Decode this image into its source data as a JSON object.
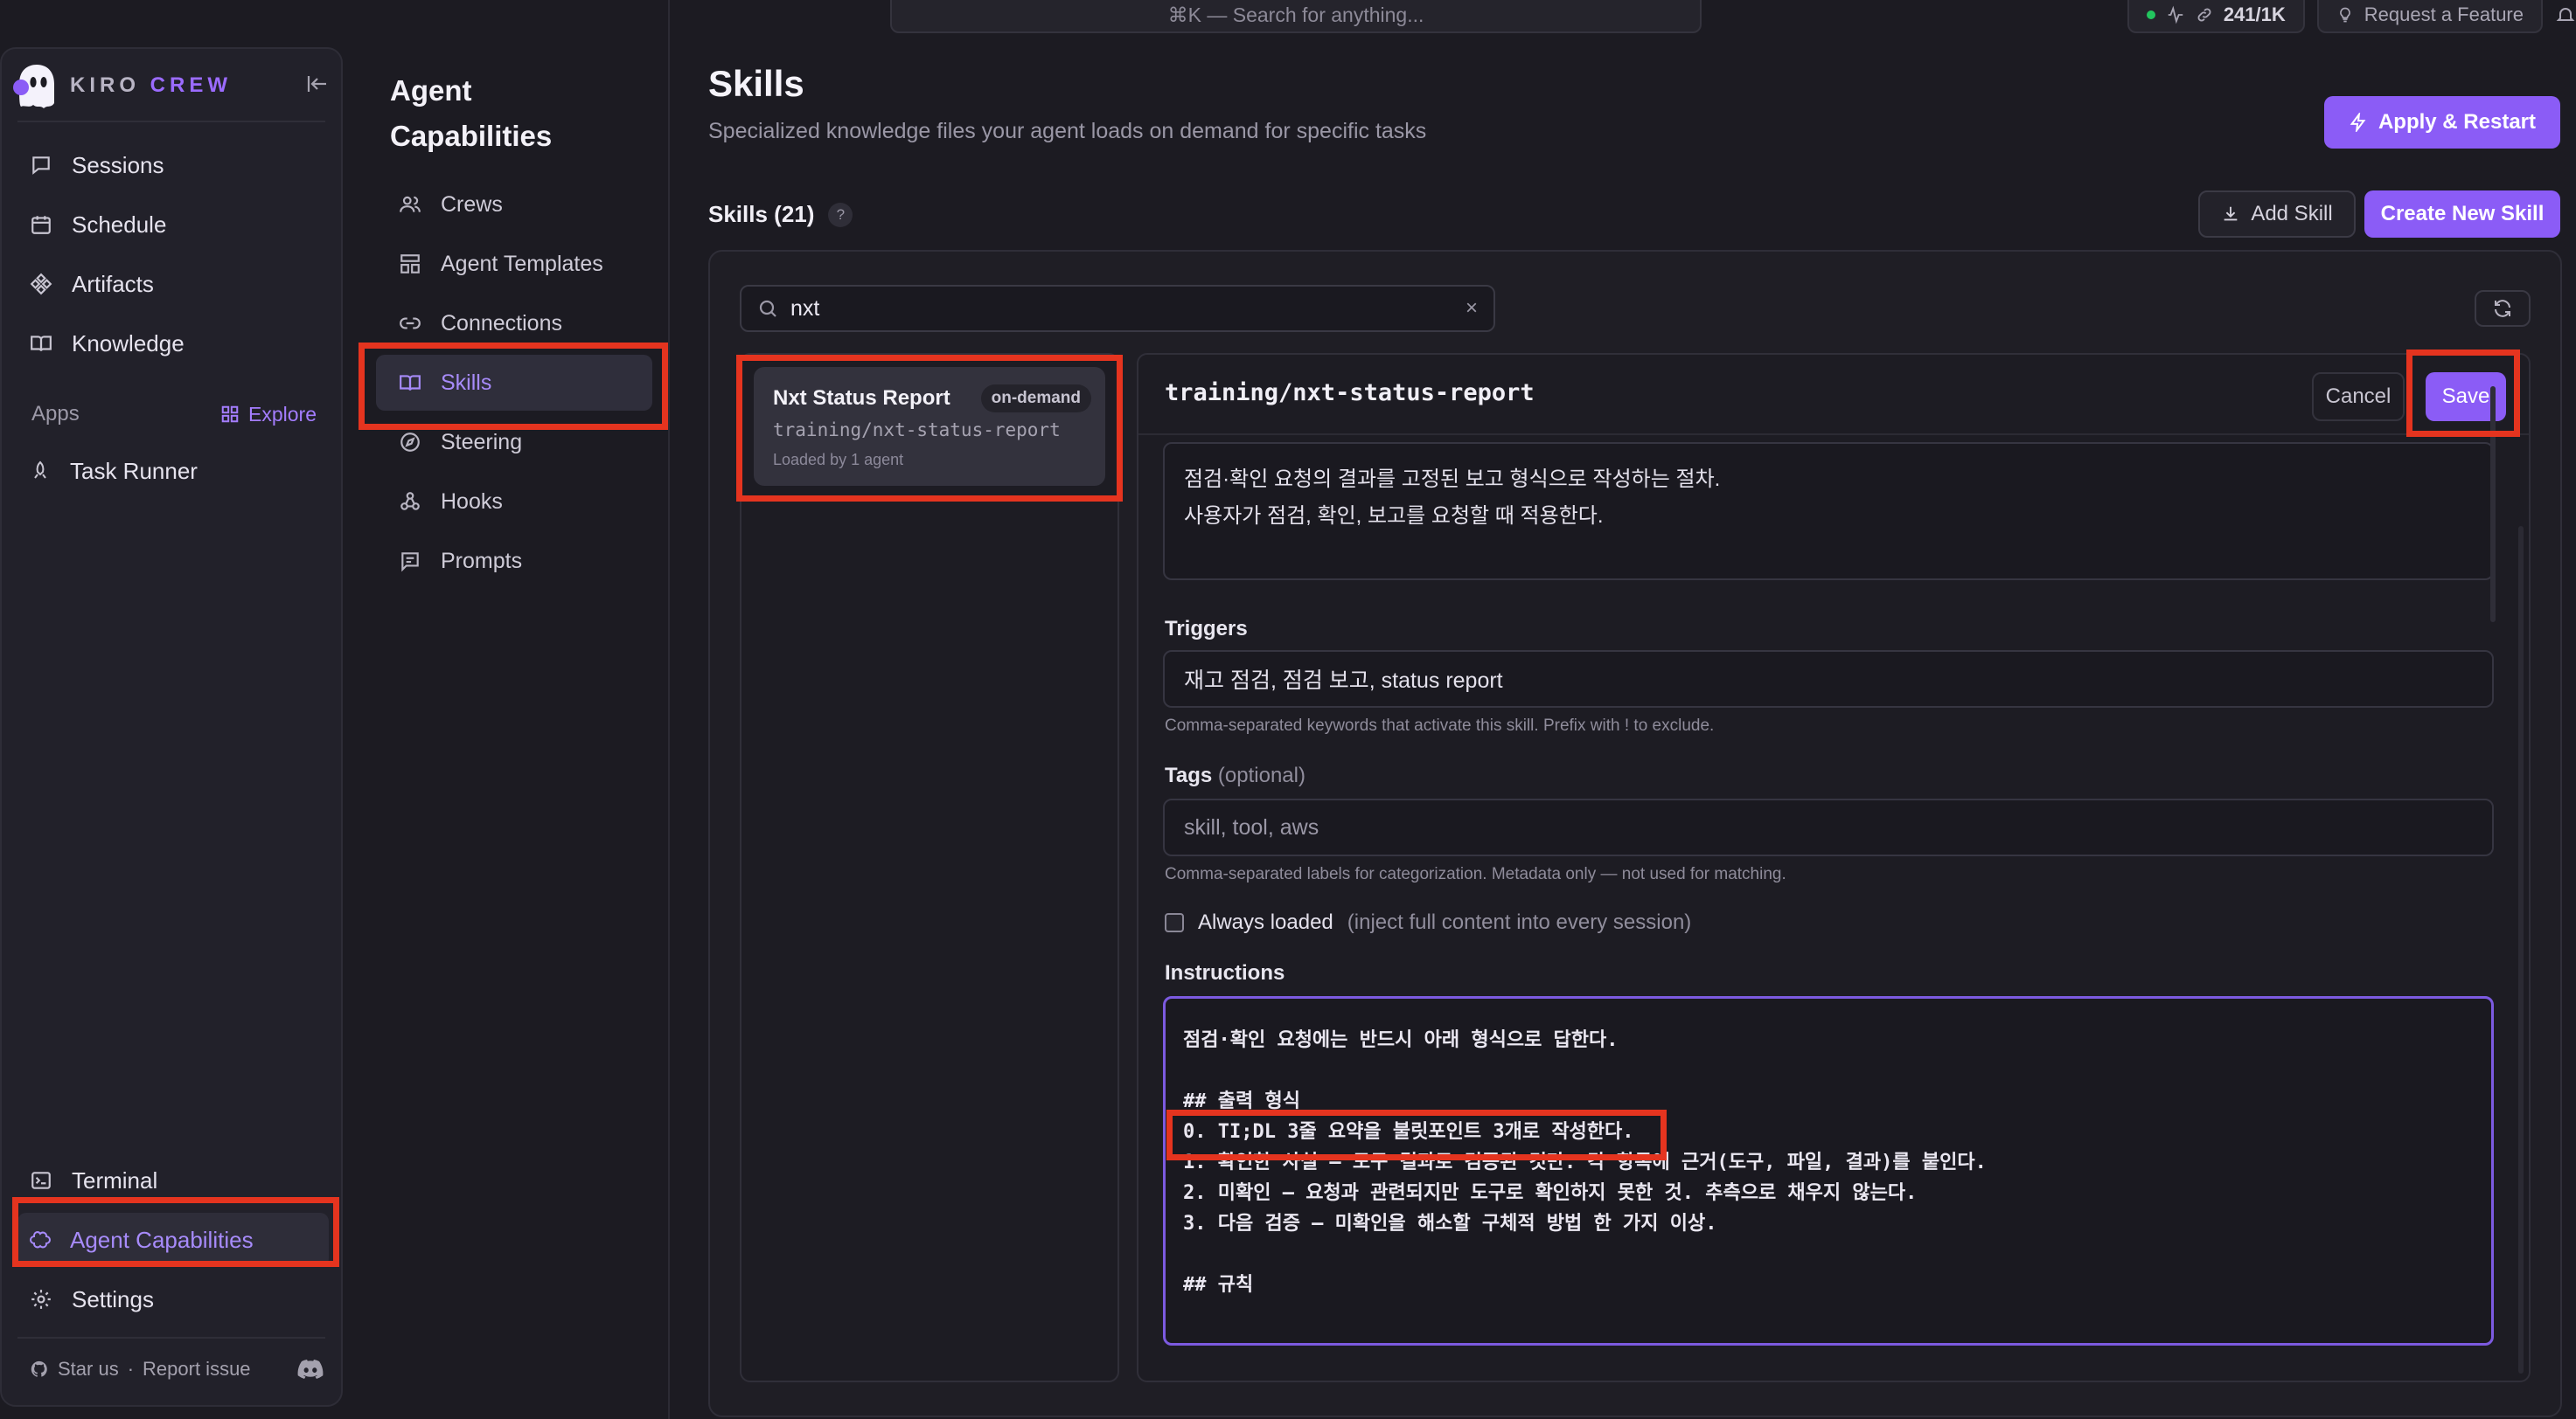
{
  "topbar": {
    "search_text": "⌘K — Search for anything...",
    "usage": "241/1K",
    "request_feature": "Request a Feature"
  },
  "brand": {
    "name_part1": "KIRO",
    "name_part2": "CREW",
    "accent": "#9b6bff"
  },
  "sidebar": {
    "items": [
      {
        "label": "Sessions",
        "icon": "chat-icon"
      },
      {
        "label": "Schedule",
        "icon": "calendar-icon"
      },
      {
        "label": "Artifacts",
        "icon": "artifacts-icon"
      },
      {
        "label": "Knowledge",
        "icon": "book-icon"
      }
    ],
    "apps_label": "Apps",
    "explore_label": "Explore",
    "task_runner": "Task Runner",
    "terminal": "Terminal",
    "agent_capabilities": "Agent Capabilities",
    "settings": "Settings",
    "star_us": "Star us",
    "separator": "·",
    "report_issue": "Report issue"
  },
  "capabilities": {
    "title_line1": "Agent",
    "title_line2": "Capabilities",
    "items": [
      {
        "label": "Crews"
      },
      {
        "label": "Agent Templates"
      },
      {
        "label": "Connections"
      },
      {
        "label": "Skills"
      },
      {
        "label": "Steering"
      },
      {
        "label": "Hooks"
      },
      {
        "label": "Prompts"
      }
    ]
  },
  "main": {
    "title": "Skills",
    "subtitle": "Specialized knowledge files your agent loads on demand for specific tasks",
    "apply_restart": "Apply & Restart",
    "skills_count": "Skills (21)",
    "help": "?",
    "add_skill": "Add Skill",
    "create_skill": "Create New Skill",
    "search_value": "nxt",
    "clear": "×"
  },
  "skill_list": [
    {
      "name": "Nxt Status Report",
      "badge": "on-demand",
      "path": "training/nxt-status-report",
      "loaded": "Loaded by 1 agent"
    }
  ],
  "editor": {
    "path": "training/nxt-status-report",
    "cancel": "Cancel",
    "save": "Save",
    "description_line1": "점검·확인 요청의 결과를 고정된 보고 형식으로 작성하는 절차.",
    "description_line2": "사용자가 점검, 확인, 보고를 요청할 때 적용한다.",
    "triggers_label": "Triggers",
    "triggers_value": "재고 점검, 점검 보고, status report",
    "triggers_hint": "Comma-separated keywords that activate this skill. Prefix with ! to exclude.",
    "tags_label": "Tags",
    "tags_optional": "(optional)",
    "tags_placeholder": "skill, tool, aws",
    "tags_hint": "Comma-separated labels for categorization. Metadata only — not used for matching.",
    "always_loaded": "Always loaded",
    "always_loaded_note": "(inject full content into every session)",
    "instructions_label": "Instructions",
    "instructions": "점검·확인 요청에는 반드시 아래 형식으로 답한다.\n\n## 출력 형식\n0. TI;DL 3줄 요약을 불릿포인트 3개로 작성한다.\n1. 확인한 사실 — 도구 결과로 검증된 것만. 각 항목에 근거(도구, 파일, 결과)를 붙인다.\n2. 미확인 — 요청과 관련되지만 도구로 확인하지 못한 것. 추측으로 채우지 않는다.\n3. 다음 검증 — 미확인을 해소할 구체적 방법 한 가지 이상.\n\n## 규칙\n"
  },
  "colors": {
    "accent": "#8b5cf6",
    "highlight": "#e5341f",
    "bg": "#1c1b22"
  }
}
